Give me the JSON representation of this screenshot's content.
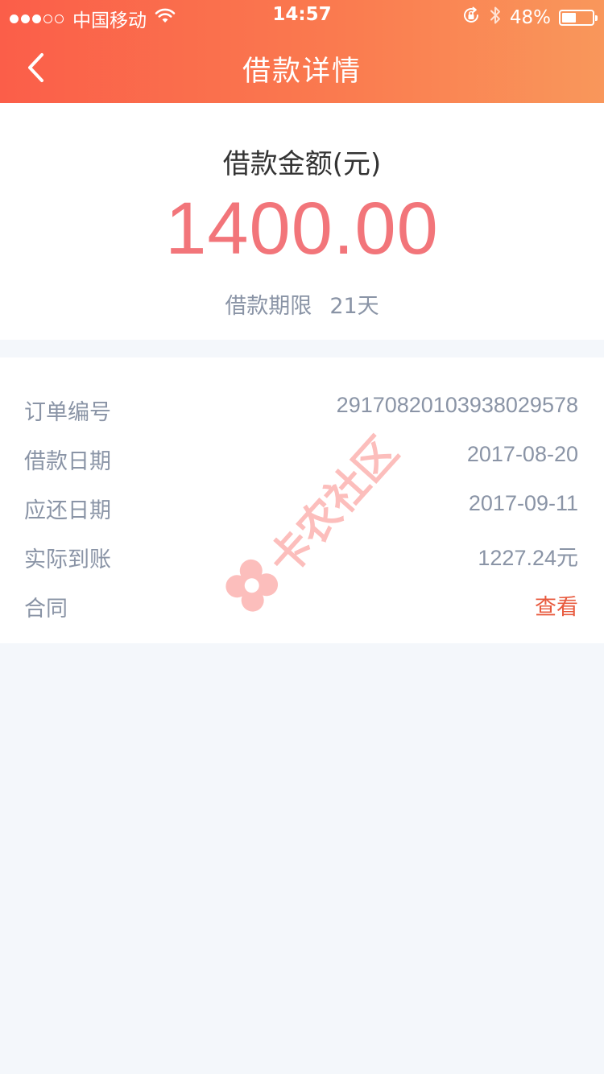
{
  "status_bar": {
    "carrier": "中国移动",
    "time": "14:57",
    "battery": "48%",
    "battery_level": 0.48,
    "signal_bars_on": 3,
    "signal_bars_total": 5,
    "icons": [
      "wifi-icon",
      "rotation-lock-icon",
      "bluetooth-icon",
      "battery-icon"
    ]
  },
  "nav": {
    "title": "借款详情",
    "back_icon": "chevron-left-icon"
  },
  "summary": {
    "amount_label": "借款金额(元)",
    "amount_value": "1400.00",
    "term_label": "借款期限",
    "term_value": "21天"
  },
  "details": {
    "rows": [
      {
        "label": "订单编号",
        "value": "2917082010393802957​8"
      },
      {
        "label": "借款日期",
        "value": "2017-08-20"
      },
      {
        "label": "应还日期",
        "value": "2017-09-11"
      },
      {
        "label": "实际到账",
        "value": "1227.24元"
      },
      {
        "label": "合同",
        "value": "查看"
      }
    ]
  },
  "watermark": {
    "text": "卡农社区"
  },
  "colors": {
    "header_start": "#fb5e49",
    "header_end": "#f9975b",
    "amount": "#f2757a",
    "link": "#e85a3e",
    "secondary_text": "#8a94a6",
    "page_background": "#f4f7fb"
  }
}
